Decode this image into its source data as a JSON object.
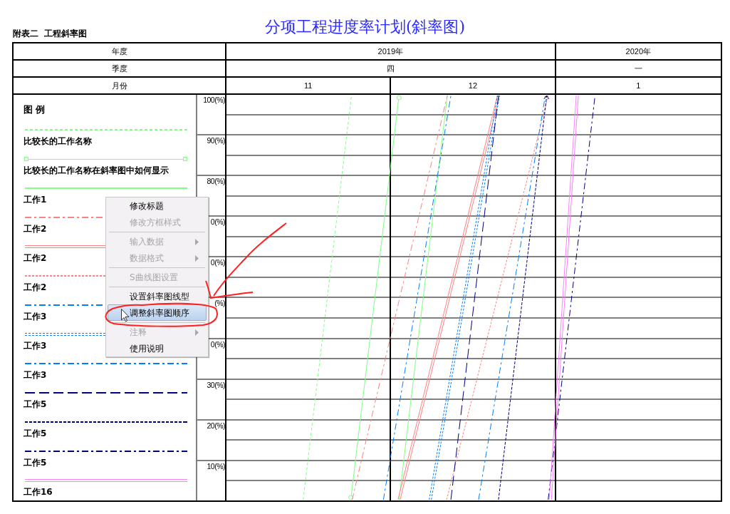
{
  "subtitle": "附表二  工程斜率图",
  "title": "分项工程进度率计划(斜率图)",
  "header_rows": [
    {
      "label": "年度",
      "cells": [
        {
          "text": "2019年",
          "wide": true
        },
        {
          "text": "2020年",
          "wide": false
        }
      ]
    },
    {
      "label": "季度",
      "cells": [
        {
          "text": "四",
          "wide": true
        },
        {
          "text": "一",
          "wide": false
        }
      ]
    },
    {
      "label": "月份",
      "cells": [
        {
          "text": "11",
          "wide": false
        },
        {
          "text": "12",
          "wide": false
        },
        {
          "text": "1",
          "wide": false
        }
      ]
    }
  ],
  "legend": {
    "title": "图 例",
    "items": [
      {
        "name": "比较长的工作名称",
        "color": "#80ff80",
        "kind": "dashed"
      },
      {
        "name": "比较长的工作名称在斜率图中如何显示",
        "color": "#80ff80",
        "kind": "circles"
      },
      {
        "name": "工作1",
        "color": "#80ff80",
        "kind": "solid"
      },
      {
        "name": "工作2",
        "color": "#ff8080",
        "kind": "dashdot"
      },
      {
        "name": "工作2",
        "color": "#ff8080",
        "kind": "double"
      },
      {
        "name": "工作2",
        "color": "#ff8080",
        "kind": "dotted"
      },
      {
        "name": "工作3",
        "color": "#0080ff",
        "kind": "dashdot"
      },
      {
        "name": "工作3",
        "color": "#0080ff",
        "kind": "doubledotted"
      },
      {
        "name": "工作3",
        "color": "#0080ff",
        "kind": "dashdot"
      },
      {
        "name": "工作5",
        "color": "#000080",
        "kind": "longdash"
      },
      {
        "name": "工作5",
        "color": "#000080",
        "kind": "arrow"
      },
      {
        "name": "工作5",
        "color": "#000080",
        "kind": "dashdot"
      },
      {
        "name": "工作16",
        "color": "#ff80ff",
        "kind": "double"
      }
    ]
  },
  "axis_labels": [
    "100(%)",
    "90(%)",
    "80(%)",
    "0(%)",
    "0(%)",
    "(%)",
    "0(%)",
    "30(%)",
    "20(%)",
    "10(%)"
  ],
  "context_menu": [
    {
      "kind": "item",
      "label": "修改标题",
      "disabled": false,
      "submenu": false,
      "selected": false
    },
    {
      "kind": "item",
      "label": "修改方框样式",
      "disabled": true,
      "submenu": false,
      "selected": false
    },
    {
      "kind": "separator"
    },
    {
      "kind": "item",
      "label": "输入数据",
      "disabled": true,
      "submenu": true,
      "selected": false
    },
    {
      "kind": "item",
      "label": "数据格式",
      "disabled": true,
      "submenu": true,
      "selected": false
    },
    {
      "kind": "separator"
    },
    {
      "kind": "item",
      "label": "S曲线图设置",
      "disabled": true,
      "submenu": false,
      "selected": false
    },
    {
      "kind": "separator"
    },
    {
      "kind": "item",
      "label": "设置斜率图线型",
      "disabled": false,
      "submenu": false,
      "selected": false
    },
    {
      "kind": "item",
      "label": "调整斜率图顺序",
      "disabled": false,
      "submenu": false,
      "selected": true
    },
    {
      "kind": "separator"
    },
    {
      "kind": "item",
      "label": "注释",
      "disabled": true,
      "submenu": true,
      "selected": false
    },
    {
      "kind": "item",
      "label": "使用说明",
      "disabled": false,
      "submenu": false,
      "selected": false
    }
  ]
}
